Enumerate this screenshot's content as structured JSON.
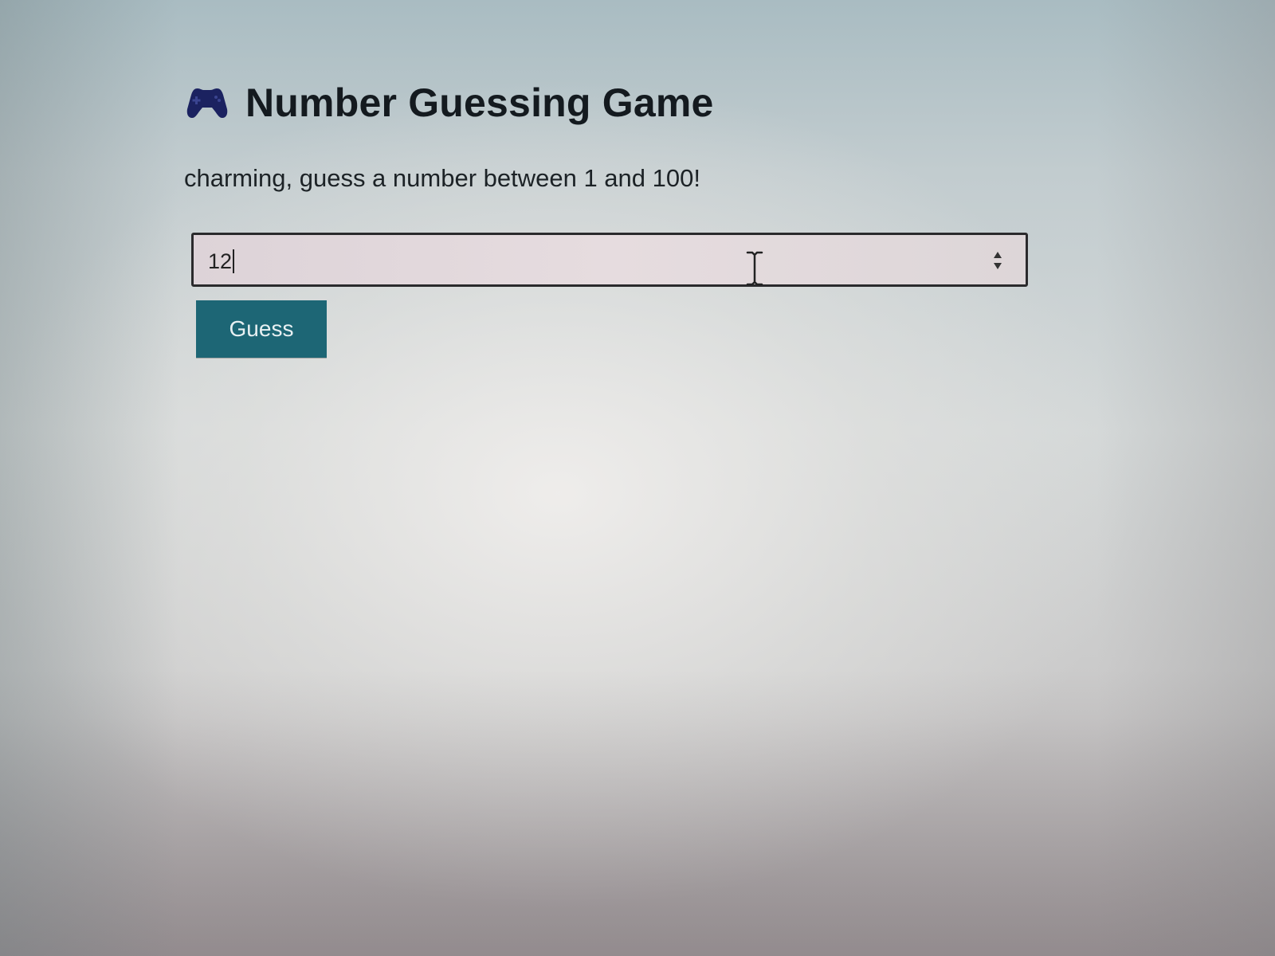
{
  "header": {
    "icon": "gamepad-icon",
    "title": "Number Guessing Game"
  },
  "prompt": {
    "text": "charming, guess a number between 1 and 100!"
  },
  "guess_input": {
    "value": "12",
    "type": "number",
    "spinner_icon": "spinner-icon"
  },
  "guess_button": {
    "label": "Guess",
    "color": "#1d6675"
  },
  "cursor": {
    "icon": "ibeam-cursor-icon"
  }
}
